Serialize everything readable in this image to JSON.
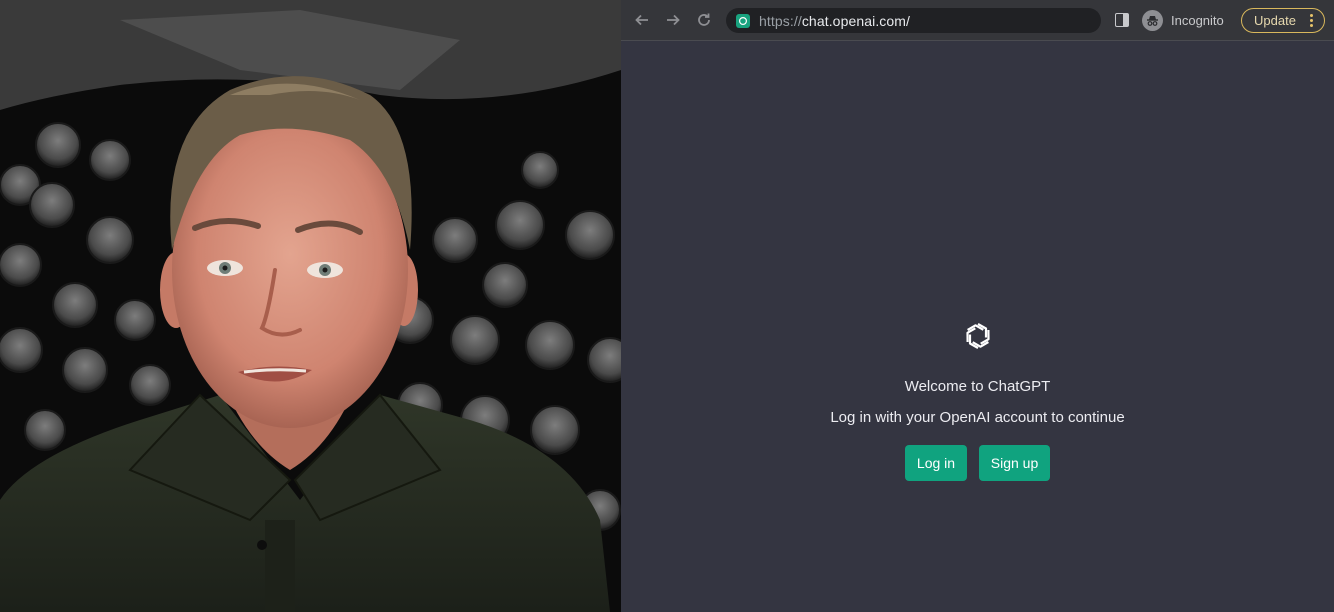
{
  "browser": {
    "url_scheme": "https://",
    "url_host": "chat.openai.com/",
    "incognito_label": "Incognito",
    "update_label": "Update",
    "accent_color": "#10a37f"
  },
  "page": {
    "welcome": "Welcome to ChatGPT",
    "subtitle": "Log in with your OpenAI account to continue",
    "login_label": "Log in",
    "signup_label": "Sign up"
  },
  "icons": [
    "back-arrow-icon",
    "forward-arrow-icon",
    "reload-icon",
    "site-favicon-icon",
    "side-panel-icon",
    "incognito-icon",
    "kebab-menu-icon",
    "openai-logo-icon"
  ]
}
